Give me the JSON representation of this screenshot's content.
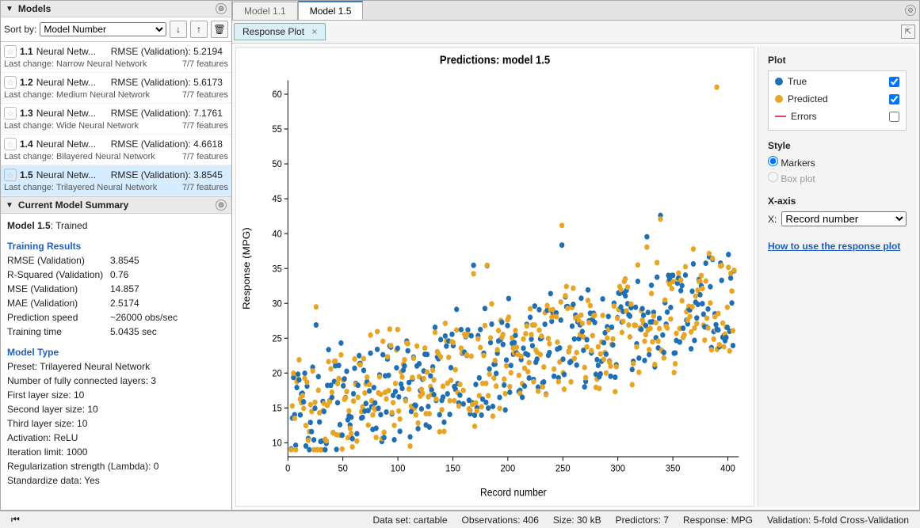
{
  "panels": {
    "models_title": "Models",
    "summary_title": "Current Model Summary"
  },
  "sort": {
    "label": "Sort by:",
    "value": "Model Number"
  },
  "models": [
    {
      "id": "1.1",
      "name": "Neural Netw...",
      "metric": "RMSE (Validation): 5.2194",
      "lc": "Last change: Narrow Neural Network",
      "ft": "7/7 features",
      "sel": false
    },
    {
      "id": "1.2",
      "name": "Neural Netw...",
      "metric": "RMSE (Validation): 5.6173",
      "lc": "Last change: Medium Neural Network",
      "ft": "7/7 features",
      "sel": false
    },
    {
      "id": "1.3",
      "name": "Neural Netw...",
      "metric": "RMSE (Validation): 7.1761",
      "lc": "Last change: Wide Neural Network",
      "ft": "7/7 features",
      "sel": false
    },
    {
      "id": "1.4",
      "name": "Neural Netw...",
      "metric": "RMSE (Validation): 4.6618",
      "lc": "Last change: Bilayered Neural Network",
      "ft": "7/7 features",
      "sel": false
    },
    {
      "id": "1.5",
      "name": "Neural Netw...",
      "metric": "RMSE (Validation): 3.8545",
      "lc": "Last change: Trilayered Neural Network",
      "ft": "7/7 features",
      "sel": true
    }
  ],
  "summary": {
    "header": "Model 1.5: Trained",
    "training_results_title": "Training Results",
    "training_results": [
      {
        "k": "RMSE (Validation)",
        "v": "3.8545"
      },
      {
        "k": "R-Squared (Validation)",
        "v": "0.76"
      },
      {
        "k": "MSE (Validation)",
        "v": "14.857"
      },
      {
        "k": "MAE (Validation)",
        "v": "2.5174"
      },
      {
        "k": "Prediction speed",
        "v": "~26000 obs/sec"
      },
      {
        "k": "Training time",
        "v": "5.0435 sec"
      }
    ],
    "model_type_title": "Model Type",
    "model_type": [
      "Preset: Trilayered Neural Network",
      "Number of fully connected layers: 3",
      "First layer size: 10",
      "Second layer size: 10",
      "Third layer size: 10",
      "Activation: ReLU",
      "Iteration limit: 1000",
      "Regularization strength (Lambda): 0",
      "Standardize data: Yes"
    ]
  },
  "tabs": {
    "file_tabs": [
      "Model 1.1",
      "Model 1.5"
    ],
    "active_file": 1,
    "inner_tab": "Response Plot"
  },
  "side": {
    "plot_title": "Plot",
    "legend": [
      {
        "label": "True",
        "checked": true,
        "color": "#1f6fb3"
      },
      {
        "label": "Predicted",
        "checked": true,
        "color": "#e8a423"
      },
      {
        "label": "Errors",
        "checked": false,
        "color": "#d46"
      }
    ],
    "style_title": "Style",
    "style_markers": "Markers",
    "style_box": "Box plot",
    "xaxis_title": "X-axis",
    "xaxis_label": "X:",
    "xaxis_value": "Record number",
    "help_link": "How to use the response plot"
  },
  "chart_data": {
    "type": "scatter",
    "title": "Predictions: model 1.5",
    "xlabel": "Record number",
    "ylabel": "Response (MPG)",
    "xlim": [
      0,
      410
    ],
    "ylim": [
      8,
      62
    ],
    "xticks": [
      0,
      50,
      100,
      150,
      200,
      250,
      300,
      350,
      400
    ],
    "yticks": [
      10,
      15,
      20,
      25,
      30,
      35,
      40,
      45,
      50,
      55,
      60
    ],
    "series": [
      {
        "name": "True",
        "color": "#1f6fb3",
        "n": 392
      },
      {
        "name": "Predicted",
        "color": "#e8a423",
        "n": 392
      }
    ],
    "note": "Scatter of ~392 MPG observations vs record index, true and predicted overlaid; values spread roughly 9..44 with upward trend; one predicted outlier near (390, 61)."
  },
  "status": {
    "dataset": "Data set: cartable",
    "obs": "Observations: 406",
    "size": "Size: 30 kB",
    "predictors": "Predictors: 7",
    "response": "Response: MPG",
    "validation": "Validation: 5-fold Cross-Validation"
  }
}
